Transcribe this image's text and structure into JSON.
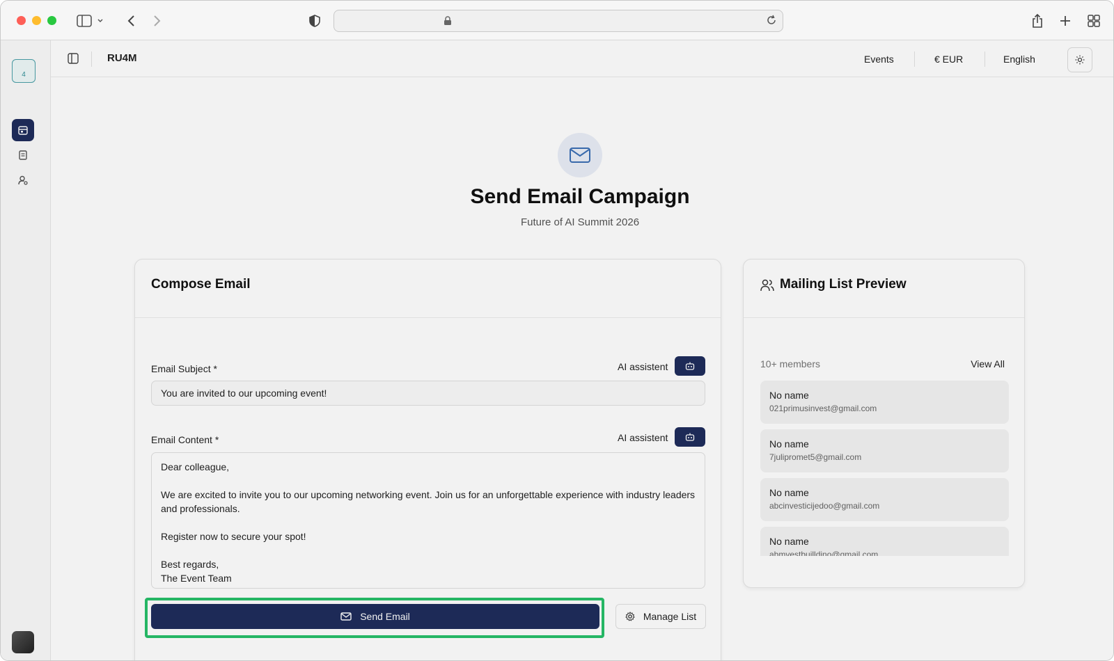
{
  "browser": {
    "url": ""
  },
  "appbar": {
    "brand": "RU4M",
    "nav_events": "Events",
    "nav_currency": "€ EUR",
    "nav_language": "English"
  },
  "sidebar": {
    "logo_text": "4"
  },
  "hero": {
    "title": "Send Email Campaign",
    "subtitle": "Future of AI Summit 2026"
  },
  "compose": {
    "title": "Compose Email",
    "subject_label": "Email Subject *",
    "ai_label_subject": "AI assistent",
    "subject_value": "You are invited to our upcoming event!",
    "content_label": "Email Content *",
    "ai_label_content": "AI assistent",
    "content_lines": {
      "l1": "Dear colleague,",
      "l2": "We are excited to invite you to our upcoming networking event. Join us for an unforgettable experience with industry leaders and professionals.",
      "l3": "Register now to secure your spot!",
      "l4": "Best regards,",
      "l5": "The Event Team"
    },
    "send_label": "Send Email",
    "manage_label": "Manage List"
  },
  "mailing": {
    "title": "Mailing List Preview",
    "count": "10+ members",
    "view_all": "View All",
    "members": [
      {
        "name": "No name",
        "email": "021primusinvest@gmail.com"
      },
      {
        "name": "No name",
        "email": "7julipromet5@gmail.com"
      },
      {
        "name": "No name",
        "email": "abcinvesticijedoo@gmail.com"
      },
      {
        "name": "No name",
        "email": "abmvestbuilldino@gmail.com"
      }
    ]
  },
  "colors": {
    "primary": "#1f2d5c",
    "highlight": "#27c06a",
    "accent_teal": "#4aa0a8"
  }
}
